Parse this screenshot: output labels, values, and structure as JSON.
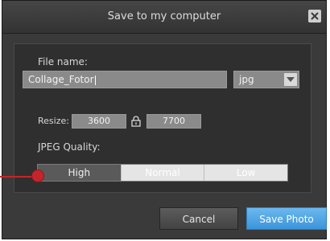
{
  "dialog": {
    "title": "Save to my computer",
    "file_name_label": "File name:",
    "file_name_value": "Collage_Fotor",
    "format_value": "jpg",
    "resize_label": "Resize:",
    "width_value": "3600",
    "height_value": "7700",
    "quality_label": "JPEG Quality:",
    "quality_options": [
      "High",
      "Normal",
      "Low"
    ],
    "quality_selected": "High",
    "cancel_label": "Cancel",
    "save_label": "Save Photo"
  },
  "colors": {
    "background": "#3a3a3a",
    "panel": "#2f2f2f",
    "accent": "#4aa3e6",
    "annotation": "#c6242c"
  },
  "icons": [
    "close-icon",
    "chevron-down-icon",
    "lock-icon"
  ]
}
